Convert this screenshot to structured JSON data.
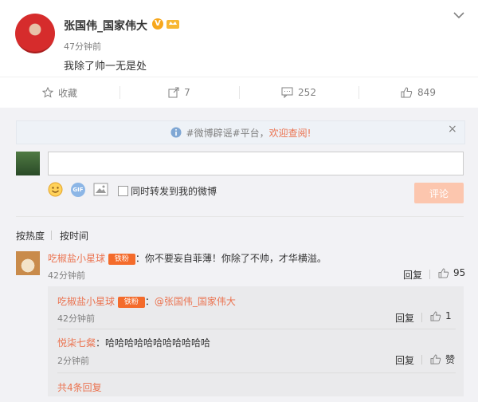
{
  "post": {
    "author": "张国伟_国家伟大",
    "badge": "V",
    "time": "47分钟前",
    "text": "我除了帅一无是处"
  },
  "actions": {
    "favorite": "收藏",
    "repost": "7",
    "comments": "252",
    "likes": "849"
  },
  "notice": {
    "prefix": "#微博辟谣#平台，",
    "link": "欢迎查阅!",
    "close": "×"
  },
  "composer": {
    "repost_label": "同时转发到我的微博",
    "submit": "评论",
    "gif": "GIF"
  },
  "sort": {
    "by_hot": "按热度",
    "by_time": "按时间"
  },
  "comments": [
    {
      "user": "吃椒盐小星球",
      "badge": "铁粉",
      "colon": "：",
      "text": "你不要妄自菲薄！你除了不帅，才华横溢。",
      "time": "42分钟前",
      "reply": "回复",
      "likes": "95",
      "replies": [
        {
          "user": "吃椒盐小星球",
          "badge": "铁粉",
          "colon": "：",
          "mention": "@张国伟_国家伟大",
          "text": "",
          "time": "42分钟前",
          "reply": "回复",
          "likes": "1"
        },
        {
          "user": "悦柒七粲",
          "colon": "：",
          "text": "哈哈哈哈哈哈哈哈哈哈哈",
          "time": "2分钟前",
          "reply": "回复",
          "likes": "赞"
        }
      ],
      "more": "共4条回复"
    }
  ]
}
